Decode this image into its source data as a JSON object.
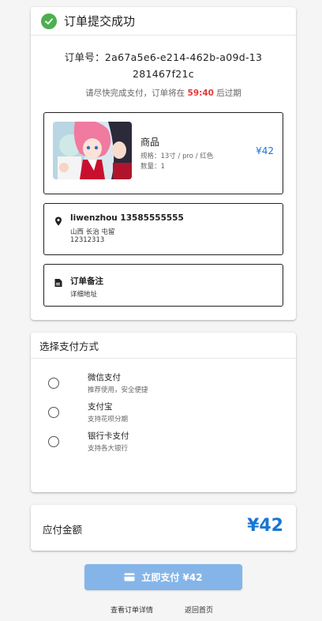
{
  "header": {
    "title": "订单提交成功",
    "icon": "check-circle-icon",
    "icon_color": "#4caf50"
  },
  "order": {
    "number": "订单号：2a67a5e6-e214-462b-a09d-13281467f21c",
    "deadline_prefix": "请尽快完成支付，订单将在 ",
    "countdown": "59:40",
    "deadline_suffix": " 后过期"
  },
  "product": {
    "name": "商品",
    "spec": "规格：13寸 / pro / 红色",
    "quantity": "数量：1",
    "price": "¥42",
    "thumbnail": "anime-artwork-image"
  },
  "address": {
    "icon": "location-pin-icon",
    "name_phone": "liwenzhou 13585555555",
    "region": "山西 长治 屯留",
    "detail": "12312313"
  },
  "note": {
    "icon": "note-icon",
    "title": "订单备注",
    "text": "详细地址"
  },
  "payment": {
    "title": "选择支付方式",
    "options": [
      {
        "name": "微信支付",
        "desc": "推荐使用，安全便捷",
        "selected": false
      },
      {
        "name": "支付宝",
        "desc": "支持花呗分期",
        "selected": false
      },
      {
        "name": "银行卡支付",
        "desc": "支持各大银行",
        "selected": false
      }
    ]
  },
  "amount": {
    "label": "应付金额",
    "value": "¥42"
  },
  "actions": {
    "pay_label": "立即支付 ¥42",
    "view_order": "查看订单详情",
    "back_home": "返回首页"
  },
  "colors": {
    "accent": "#1976d2",
    "button": "#85b5e8",
    "countdown": "#e53935",
    "success": "#4caf50"
  }
}
